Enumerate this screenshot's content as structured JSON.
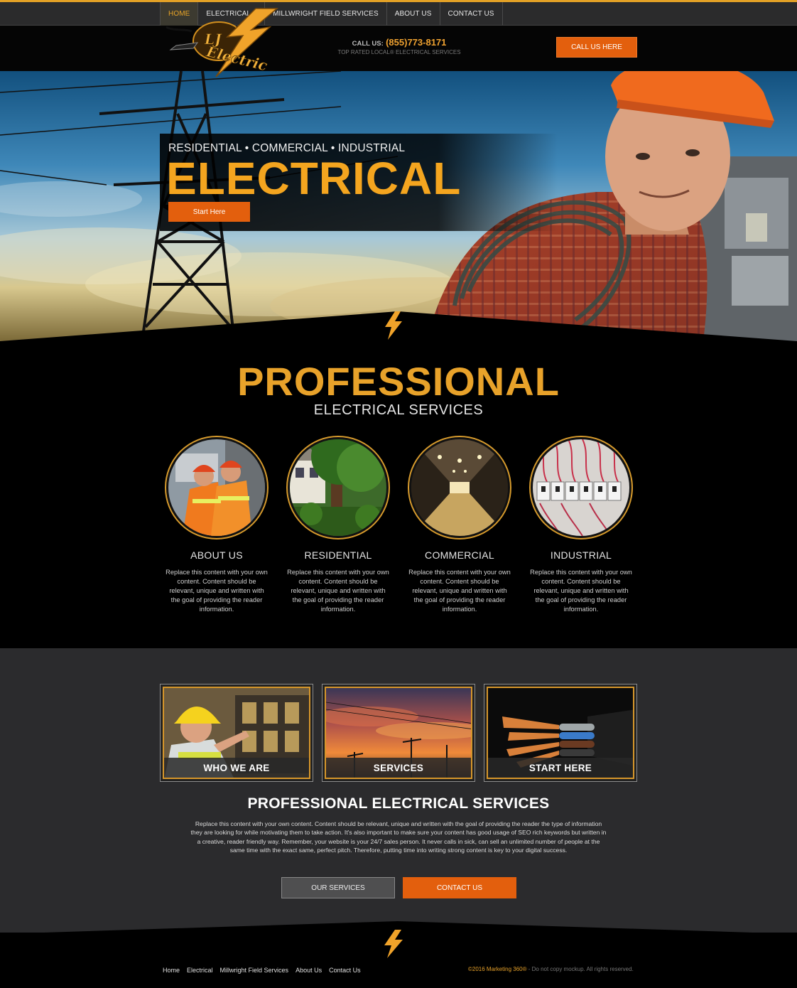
{
  "nav": {
    "items": [
      {
        "label": "HOME",
        "active": true
      },
      {
        "label": "ELECTRICAL",
        "dropdown": true
      },
      {
        "label": "MILLWRIGHT FIELD SERVICES"
      },
      {
        "label": "ABOUT US"
      },
      {
        "label": "CONTACT US"
      }
    ]
  },
  "header": {
    "logo_text": "LJ Electric",
    "call_label": "CALL US:",
    "phone": "(855)773-8171",
    "tagline": "TOP RATED LOCAL® ELECTRICAL SERVICES",
    "call_button": "CALL US HERE"
  },
  "hero": {
    "subtitle": "RESIDENTIAL • COMMERCIAL • INDUSTRIAL",
    "title": "ELECTRICAL",
    "button": "Start Here"
  },
  "professional": {
    "title": "PROFESSIONAL",
    "subtitle": "ELECTRICAL SERVICES",
    "services": [
      {
        "title": "ABOUT US",
        "text": "Replace this content with your own content. Content should be relevant, unique and written with the goal of providing the reader information."
      },
      {
        "title": "RESIDENTIAL",
        "text": "Replace this content with your own content. Content should be relevant, unique and written with the goal of providing the reader information."
      },
      {
        "title": "COMMERCIAL",
        "text": "Replace this content with your own content. Content should be relevant, unique and written with the goal of providing the reader information."
      },
      {
        "title": "INDUSTRIAL",
        "text": "Replace this content with your own content. Content should be relevant, unique and written with the goal of providing the reader information."
      }
    ]
  },
  "features": {
    "cards": [
      {
        "label": "WHO WE ARE"
      },
      {
        "label": "SERVICES"
      },
      {
        "label": "START HERE"
      }
    ],
    "title": "PROFESSIONAL ELECTRICAL SERVICES",
    "text": "Replace this content with your own content. Content should be relevant, unique and written with the goal of providing the reader the type of information they are looking for while motivating them to take action. It's also important to make sure your content has good usage of SEO rich keywords but written in a creative, reader friendly way. Remember, your website is your 24/7 sales person. It never calls in sick, can sell an unlimited number of people at the same time with the exact same, perfect pitch. Therefore, putting time into writing strong content is key to your digital success.",
    "button_services": "OUR SERVICES",
    "button_contact": "CONTACT US"
  },
  "footer": {
    "links": [
      "Home",
      "Electrical",
      "Millwright Field Services",
      "About Us",
      "Contact Us"
    ],
    "copyright_highlight": "©2016 Marketing 360®",
    "copyright_rest": " - Do not copy mockup. All rights reserved."
  },
  "colors": {
    "accent_orange": "#e35f0d",
    "accent_gold": "#e8a22a",
    "nav_bg": "#2b2b2c",
    "section_dark": "#2b2b2d"
  },
  "icons": [
    "lightning-bolt-icon",
    "caret-down-icon"
  ]
}
